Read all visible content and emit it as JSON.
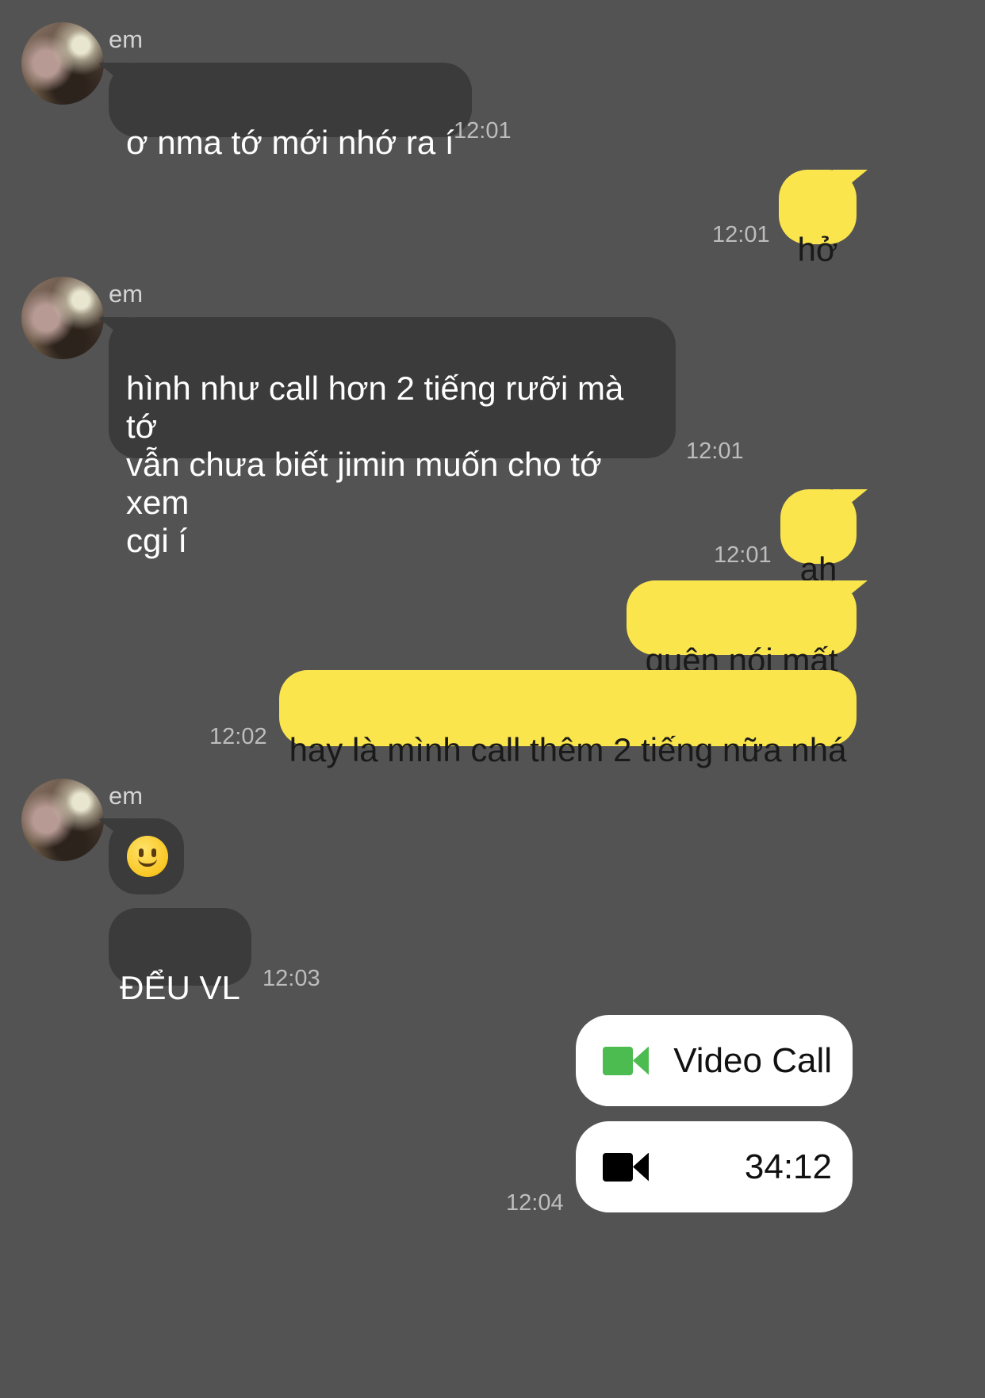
{
  "colors": {
    "background": "#535353",
    "incoming_bubble": "#3b3b3b",
    "outgoing_bubble": "#fae54d",
    "video_icon_green": "#4cbb50",
    "video_icon_black": "#000000"
  },
  "messages": [
    {
      "sender": "em",
      "text": "ơ nma tớ mới nhớ ra í",
      "time": "12:01"
    },
    {
      "text": "hở",
      "time": "12:01"
    },
    {
      "sender": "em",
      "text": "hình như call hơn 2 tiếng rưỡi mà tớ\nvẫn chưa biết jimin muốn cho tớ xem\ncgi í",
      "time": "12:01"
    },
    {
      "text": "ah",
      "time": "12:01"
    },
    {
      "text": "quên nói mất"
    },
    {
      "text": "hay là mình call thêm 2 tiếng nữa nhá",
      "time": "12:02"
    },
    {
      "sender": "em",
      "emoji": "slightly-smiling-face-icon"
    },
    {
      "text": "ĐỂU VL",
      "time": "12:03"
    },
    {
      "call_label": "Video Call",
      "icon": "video-camera-icon"
    },
    {
      "call_duration": "34:12",
      "icon": "video-camera-icon",
      "time": "12:04"
    }
  ]
}
